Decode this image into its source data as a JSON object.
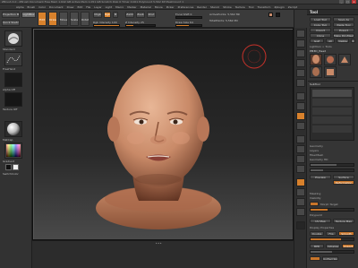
{
  "window": {
    "title": "ZBrush  4.0 - ZBrush Document   Free Mem 1.642 GB   Active Mem 1.051 GB   Scratch Disk 0   Timer 0.001   PolyCount 5,562 KP   MeshCount 1",
    "buttons": [
      "_",
      "□",
      "x"
    ]
  },
  "menubar": {
    "items": [
      "Alpha",
      "Brush",
      "Color",
      "Document",
      "Draw",
      "Edit",
      "File",
      "Layer",
      "Light",
      "Macro",
      "Marker",
      "Material",
      "Movie",
      "Picker",
      "Preferences",
      "Render",
      "Stencil",
      "Stroke",
      "Texture",
      "Tool",
      "Transform",
      "Zplugin",
      "Zscript"
    ]
  },
  "toolbar": {
    "projection_master": "Projection Master",
    "lightbox": "LightBox",
    "quick_sketch": "Quick Sketch",
    "edit": "Edit",
    "draw": "Draw",
    "move": "Move",
    "scale": "Scale",
    "rotate": "Rotate",
    "mrgb": "Mrgb",
    "rgb": "Rgb",
    "m": "M",
    "zadd": "Zadd",
    "zsub": "Zsub",
    "zcut": "Zcut",
    "focal_shift_label": "Focal Shift",
    "focal_shift_value": "0",
    "draw_size_label": "Draw Size",
    "draw_size_value": "64",
    "rgb_intensity_label": "Rgb Intensity",
    "rgb_intensity_value": "100",
    "z_intensity_label": "Z Intensity",
    "z_intensity_value": "25",
    "active_points_label": "ActivePoints:",
    "active_points_value": "5,562 Mil",
    "total_points_label": "TotalPoints:",
    "total_points_value": "5,562 Mil",
    "rgb_intensity_fraction": 1.0,
    "z_intensity_fraction": 0.25,
    "draw_size_fraction": 0.5
  },
  "leftpanel": {
    "labels": [
      "Standard",
      "FreeHand",
      "Alpha Off",
      "Texture Off",
      "MatCap",
      "Gradient",
      "SwitchColor",
      "Alternate"
    ]
  },
  "rightpanel": {
    "header": "Tool",
    "buttons": [
      "Load Tool",
      "Save As",
      "Copy Tool",
      "Paste Tool",
      "Import",
      "Export",
      "Clone",
      "Make PolyMesh3D",
      "GoZ",
      "All",
      "Visible",
      "R",
      "Lightbox > Tools",
      "PM3D_Head",
      "SubTool",
      "Geometry",
      "Layers",
      "FiberMesh",
      "Geometry HD",
      "Preview",
      "Surface",
      "Deformation",
      "Masking",
      "Visibility",
      "Polygroups",
      "Contact",
      "Morph Target",
      "Polypaint",
      "UV Map",
      "Texture Map",
      "Displacement Map",
      "Normal Map",
      "Display Properties",
      "Unified Skin",
      "Initialize",
      "Import",
      "Export"
    ],
    "subtool_label": "SubTool",
    "polypaint_label": "Polypaint",
    "morph_label": "Morph Target",
    "display_label": "Display Properties",
    "double_label": "Double",
    "flip_label": "Flip",
    "smooth_label": "Smooth",
    "bpr_label": "BPR",
    "colors": {
      "accent": "#d8812c",
      "panel": "#353535",
      "canvas_top": "#1b1b1b",
      "skin": "#d9a17f"
    }
  },
  "canvas": {
    "brush_cursor": "brush-circle"
  },
  "statusbar": {
    "mark": "▴ ▴ ▴"
  }
}
